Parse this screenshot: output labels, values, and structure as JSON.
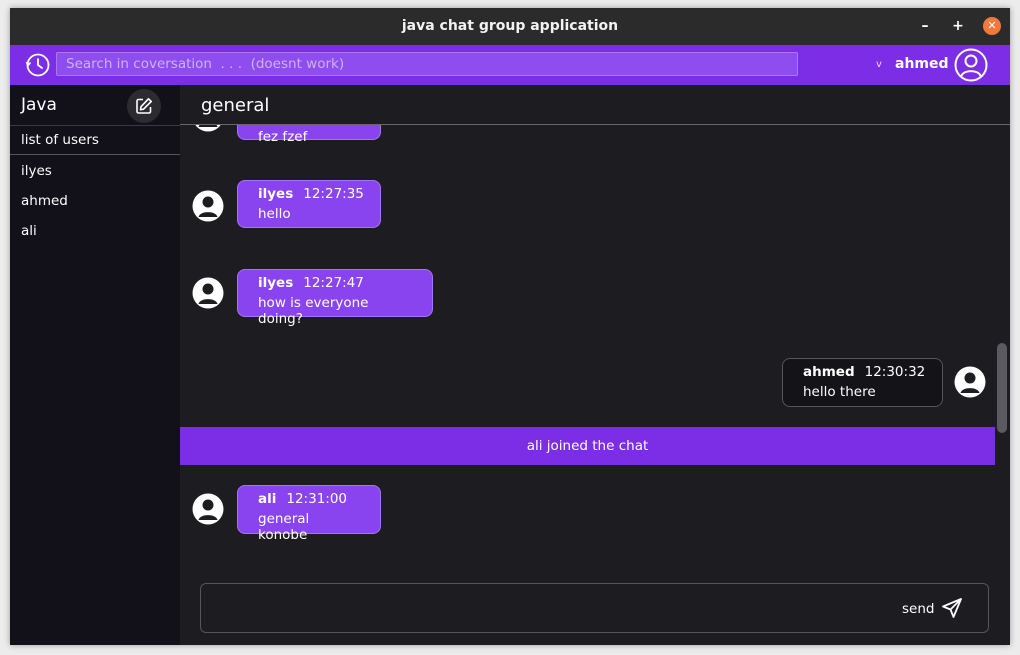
{
  "window": {
    "title": "java chat group application",
    "controls": {
      "minimize": "–",
      "maximize": "+",
      "close": "✕"
    }
  },
  "header": {
    "search_placeholder": "Search in coversation  . . .  (doesnt work)",
    "user_name": "ahmed",
    "chevron": "v"
  },
  "sidebar": {
    "group_title": "Java",
    "users_header": "list of users",
    "users": [
      "ilyes",
      "ahmed",
      "ali"
    ]
  },
  "channel": {
    "name": "general",
    "messages": [
      {
        "author": "",
        "time": "",
        "text": "fez fzef"
      },
      {
        "author": "ilyes",
        "time": "12:27:35",
        "text": "hello"
      },
      {
        "author": "ilyes",
        "time": "12:27:47",
        "text": "how is everyone doing?"
      },
      {
        "author": "ahmed",
        "time": "12:30:32",
        "text": "hello there",
        "mine": true
      },
      {
        "author": "ali",
        "time": "12:31:00",
        "text": "general konobe"
      }
    ],
    "system_message": "ali joined the chat"
  },
  "composer": {
    "value": "",
    "send_label": "send"
  },
  "colors": {
    "accent": "#7c2ee6",
    "bubble": "#8a44ef",
    "background": "#1c1c21",
    "sidebar": "#121019"
  }
}
